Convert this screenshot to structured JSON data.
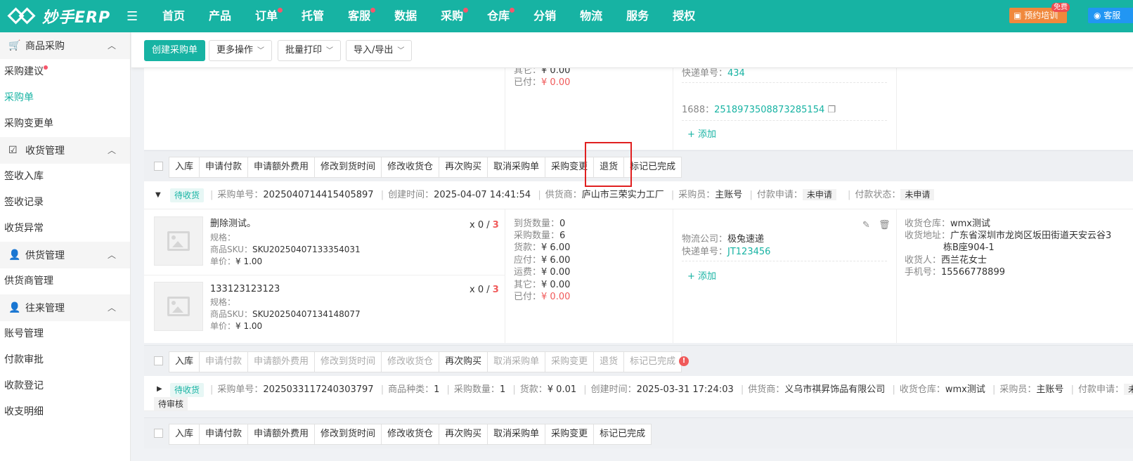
{
  "app": {
    "logo_text": "妙手ERP",
    "menu_icon": "hamburger-icon"
  },
  "nav": [
    {
      "label": "首页",
      "dot": false
    },
    {
      "label": "产品",
      "dot": false
    },
    {
      "label": "订单",
      "dot": true
    },
    {
      "label": "托管",
      "dot": false
    },
    {
      "label": "客服",
      "dot": true
    },
    {
      "label": "数据",
      "dot": false
    },
    {
      "label": "采购",
      "dot": true
    },
    {
      "label": "仓库",
      "dot": true
    },
    {
      "label": "分销",
      "dot": false
    },
    {
      "label": "物流",
      "dot": false
    },
    {
      "label": "服务",
      "dot": false
    },
    {
      "label": "授权",
      "dot": false
    }
  ],
  "header_right": {
    "training": "预约培训",
    "free_badge": "免费",
    "service": "客服"
  },
  "sidebar": {
    "groups": [
      {
        "title": "商品采购",
        "icon": "cart-icon",
        "items": [
          {
            "label": "采购建议",
            "dot": true
          },
          {
            "label": "采购单",
            "active": true
          },
          {
            "label": "采购变更单"
          }
        ]
      },
      {
        "title": "收货管理",
        "icon": "clipboard-check-icon",
        "items": [
          {
            "label": "签收入库"
          },
          {
            "label": "签收记录"
          },
          {
            "label": "收货异常"
          }
        ]
      },
      {
        "title": "供货管理",
        "icon": "supplier-user-icon",
        "items": [
          {
            "label": "供货商管理"
          }
        ]
      },
      {
        "title": "往来管理",
        "icon": "user-icon",
        "items": [
          {
            "label": "账号管理"
          },
          {
            "label": "付款审批"
          },
          {
            "label": "收款登记"
          },
          {
            "label": "收支明细"
          }
        ]
      }
    ]
  },
  "toolbar": {
    "create": "创建采购单",
    "more": "更多操作",
    "print": "批量打印",
    "import_export": "导入/导出"
  },
  "top_card": {
    "other": "其它：",
    "other_val": "¥ 0.00",
    "paid": "已付：",
    "paid_val": "¥ 0.00",
    "express_label": "快递单号：",
    "express_val": "434",
    "src_label": "1688：",
    "src_val": "2518973508873285154",
    "add": "+ 添加"
  },
  "action_bar_1": [
    "入库",
    "申请付款",
    "申请额外费用",
    "修改到货时间",
    "修改收货仓",
    "再次购买",
    "取消采购单",
    "采购变更",
    "退货",
    "标记已完成"
  ],
  "order1": {
    "status": "待收货",
    "no_label": "采购单号：",
    "no": "2025040714415405897",
    "created_label": "创建时间：",
    "created": "2025-04-07 14:41:54",
    "supplier_label": "供货商：",
    "supplier": "庐山市三荣实力工厂",
    "buyer_label": "采购员：",
    "buyer": "主账号",
    "pay_apply_label": "付款申请：",
    "pay_apply": "未申请",
    "pay_status_label": "付款状态：",
    "pay_status": "未申请",
    "items": [
      {
        "name": "删除测试。",
        "spec": "规格：",
        "sku_label": "商品SKU：",
        "sku": "SKU20250407133354031",
        "price_label": "单价：",
        "price": "¥ 1.00",
        "qty": "x 0 / ",
        "qty_total": "3"
      },
      {
        "name": "133123123123",
        "spec": "规格：",
        "sku_label": "商品SKU：",
        "sku": "SKU20250407134148077",
        "price_label": "单价：",
        "price": "¥ 1.00",
        "qty": "x 0 / ",
        "qty_total": "3"
      }
    ],
    "amounts": [
      {
        "label": "到货数量：",
        "value": "0"
      },
      {
        "label": "采购数量：",
        "value": "6"
      },
      {
        "label": "货款：",
        "value": "¥ 6.00"
      },
      {
        "label": "应付：",
        "value": "¥ 6.00"
      },
      {
        "label": "运费：",
        "value": "¥ 0.00"
      },
      {
        "label": "其它：",
        "value": "¥ 0.00"
      },
      {
        "label": "已付：",
        "value": "¥ 0.00"
      }
    ],
    "logistics_label": "物流公司：",
    "logistics": "极兔速递",
    "express_label": "快递单号：",
    "express": "JT123456",
    "add": "+ 添加",
    "warehouse_label": "收货仓库：",
    "warehouse": "wmx测试",
    "address_label": "收货地址：",
    "address_line1": "广东省深圳市龙岗区坂田街道天安云谷3",
    "address_line2": "栋B座904-1",
    "receiver_label": "收货人：",
    "receiver": "西兰花女士",
    "phone_label": "手机号：",
    "phone": "15566778899"
  },
  "action_bar_2": [
    "入库",
    "申请付款",
    "申请额外费用",
    "修改到货时间",
    "修改收货仓",
    "再次购买",
    "取消采购单",
    "采购变更",
    "退货",
    "标记已完成"
  ],
  "order2": {
    "status": "待收货",
    "no_label": "采购单号：",
    "no": "2025033117240303797",
    "kinds_label": "商品种类：",
    "kinds": "1",
    "qty_label": "采购数量：",
    "qty": "1",
    "goods_label": "货款：",
    "goods": "¥ 0.01",
    "created_label": "创建时间：",
    "created": "2025-03-31 17:24:03",
    "supplier_label": "供货商：",
    "supplier": "义乌市祺昇饰品有限公司",
    "warehouse_label": "收货仓库：",
    "warehouse": "wmx测试",
    "buyer_label": "采购员：",
    "buyer": "主账号",
    "pay_apply_label": "付款申请：",
    "pay_apply_cut": "未申",
    "sub_status": "待审核"
  },
  "action_bar_3": [
    "入库",
    "申请付款",
    "申请额外费用",
    "修改到货时间",
    "修改收货仓",
    "再次购买",
    "取消采购单",
    "采购变更",
    "标记已完成"
  ]
}
